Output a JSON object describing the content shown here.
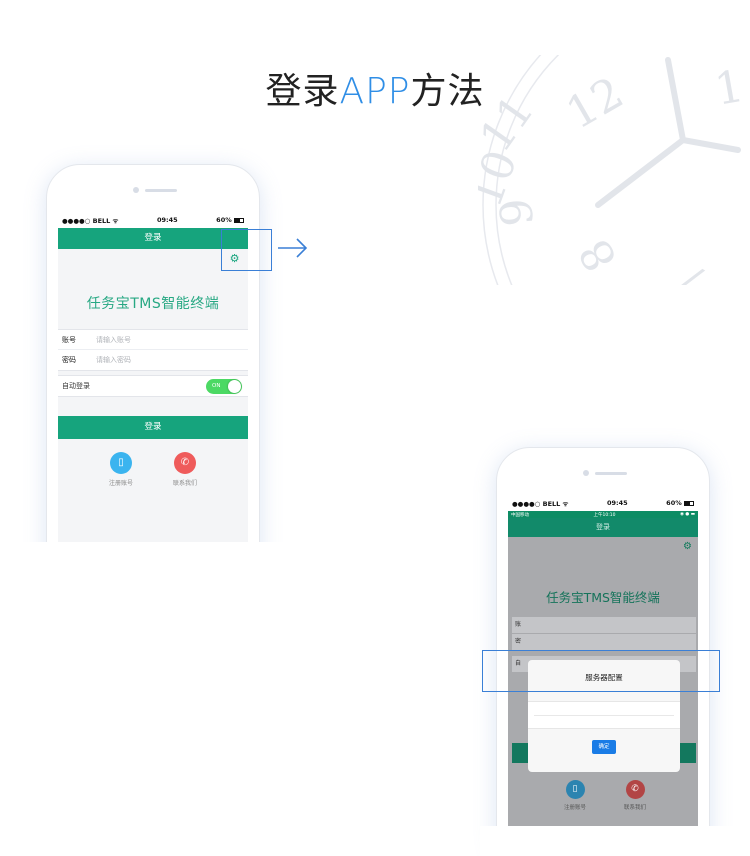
{
  "page": {
    "title_part1": "登录",
    "title_accent": "APP",
    "title_part2": "方法"
  },
  "phone_login": {
    "status": {
      "carrier": "●●●●○ BELL ᯤ",
      "time": "09:45",
      "battery": "60%"
    },
    "navbar_title": "登录",
    "brand": "任务宝TMS智能终端",
    "account_label": "账号",
    "account_placeholder": "请输入账号",
    "password_label": "密码",
    "password_placeholder": "请输入密码",
    "auto_login_label": "自动登录",
    "toggle_label": "ON",
    "login_button": "登录",
    "register_label": "注册账号",
    "contact_label": "联系我们",
    "colors": {
      "primary": "#16a47d",
      "toggle": "#4cd964",
      "register": "#3bb4ef",
      "contact": "#ef5b5b"
    }
  },
  "phone_config": {
    "status": {
      "carrier": "●●●●○ BELL ᯤ",
      "time": "09:45",
      "battery": "60%"
    },
    "sub_status": {
      "carrier": "中国移动",
      "time": "上午10:10"
    },
    "navbar_title": "登录",
    "brand": "任务宝TMS智能终端",
    "account_label_partial": "账",
    "password_label_partial": "密",
    "auto_label_partial": "自",
    "register_label": "注册账号",
    "contact_label": "联系我们",
    "dialog": {
      "title": "服务器配置",
      "ok_button": "确定"
    }
  },
  "icons": {
    "settings": "gear-icon",
    "arrow": "arrow-right-icon",
    "register": "phone-icon",
    "contact": "call-icon"
  },
  "accent_color": "#2f8ee6",
  "highlight_color": "#3a7fd6"
}
